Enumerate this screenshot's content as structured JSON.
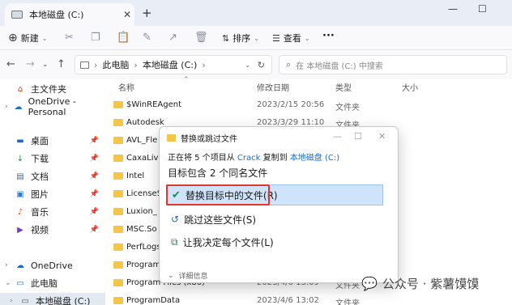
{
  "tab": {
    "title": "本地磁盘 (C:)"
  },
  "window": {
    "minimize": "—",
    "maximize": "☐",
    "new_tab": "+"
  },
  "toolbar": {
    "new_label": "新建",
    "sort_label": "排序",
    "view_label": "查看",
    "more": "···"
  },
  "address": {
    "crumb1": "此电脑",
    "crumb2": "本地磁盘 (C:)",
    "search_placeholder": "在 本地磁盘 (C:) 中搜索"
  },
  "sidebar": {
    "items": [
      {
        "label": "主文件夹",
        "icon": "home-icon"
      },
      {
        "label": "OneDrive - Personal",
        "icon": "cloud-icon"
      },
      {
        "label": "桌面",
        "icon": "desktop-icon"
      },
      {
        "label": "下载",
        "icon": "download-icon"
      },
      {
        "label": "文档",
        "icon": "document-icon"
      },
      {
        "label": "图片",
        "icon": "image-icon"
      },
      {
        "label": "音乐",
        "icon": "music-icon"
      },
      {
        "label": "视频",
        "icon": "video-icon"
      },
      {
        "label": "OneDrive",
        "icon": "cloud-icon"
      },
      {
        "label": "此电脑",
        "icon": "pc-icon"
      },
      {
        "label": "本地磁盘 (C:)",
        "icon": "drive-icon"
      }
    ]
  },
  "columns": {
    "name": "名称",
    "date": "修改日期",
    "type": "类型",
    "size": "大小"
  },
  "files": [
    {
      "name": "$WinREAgent",
      "date": "2023/2/15 20:56",
      "type": "文件夹"
    },
    {
      "name": "Autodesk",
      "date": "2023/3/29 11:10",
      "type": "文件夹"
    },
    {
      "name": "AVL_Fle",
      "date": "",
      "type": ""
    },
    {
      "name": "CaxaLive",
      "date": "",
      "type": ""
    },
    {
      "name": "Intel",
      "date": "",
      "type": ""
    },
    {
      "name": "LicenseS",
      "date": "",
      "type": ""
    },
    {
      "name": "Luxion_",
      "date": "",
      "type": ""
    },
    {
      "name": "MSC.So",
      "date": "",
      "type": ""
    },
    {
      "name": "PerfLogs",
      "date": "",
      "type": ""
    },
    {
      "name": "Program",
      "date": "",
      "type": ""
    },
    {
      "name": "Program Files (x86)",
      "date": "2023/4/6 13:09",
      "type": "文件夹"
    },
    {
      "name": "ProgramData",
      "date": "2023/4/6 13:02",
      "type": "文件夹"
    }
  ],
  "dialog": {
    "title": "替换或跳过文件",
    "line1_prefix": "正在将 5 个项目从",
    "line1_src": "Crack",
    "line1_mid": "复制到",
    "line1_dst": "本地磁盘 (C:)",
    "line2": "目标包含 2 个同名文件",
    "option_replace": "替换目标中的文件(R)",
    "option_skip": "跳过这些文件(S)",
    "option_decide": "让我决定每个文件(L)",
    "details": "详细信息"
  },
  "watermark": "公众号 · 紫薯馍馍",
  "colors": {
    "accent": "#1a6cc7",
    "highlight": "#cfe3fb",
    "outline": "#e0362c",
    "folder": "#f3c64b"
  }
}
